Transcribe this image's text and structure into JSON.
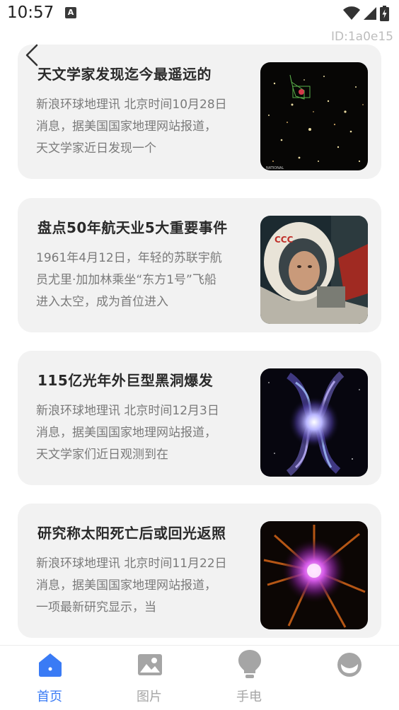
{
  "status_bar": {
    "time": "10:57",
    "notification_icon": "a-icon",
    "icons": [
      "wifi-icon",
      "signal-icon",
      "battery-icon"
    ]
  },
  "id_label": "ID:1a0e15",
  "back_icon": "back-arrow-icon",
  "articles": [
    {
      "title": "天文学家发现迄今最遥远的",
      "description": "新浪环球地理讯 北京时间10月28日消息，据美国国家地理网站报道，天文学家近日发现一个",
      "image": "galaxy-field-image"
    },
    {
      "title": "盘点50年航天业5大重要事件",
      "description": "1961年4月12日，年轻的苏联宇航员尤里·加加林乘坐“东方1号”飞船进入太空，成为首位进入",
      "image": "astronaut-image"
    },
    {
      "title": "115亿光年外巨型黑洞爆发",
      "description": "新浪环球地理讯 北京时间12月3日消息，据美国国家地理网站报道，天文学家们近日观测到在",
      "image": "black-hole-image"
    },
    {
      "title": "研究称太阳死亡后或回光返照",
      "description": "新浪环球地理讯 北京时间11月22日消息，据美国国家地理网站报道，一项最新研究显示，当",
      "image": "dying-sun-image"
    }
  ],
  "bottom_nav": {
    "active_color": "#3a7bf5",
    "inactive_color": "#a5a5a5",
    "items": [
      {
        "label": "首页",
        "icon": "home-icon",
        "active": true
      },
      {
        "label": "图片",
        "icon": "image-icon",
        "active": false
      },
      {
        "label": "手电",
        "icon": "lightbulb-icon",
        "active": false
      },
      {
        "label": "",
        "icon": "profile-icon",
        "active": false
      }
    ]
  }
}
